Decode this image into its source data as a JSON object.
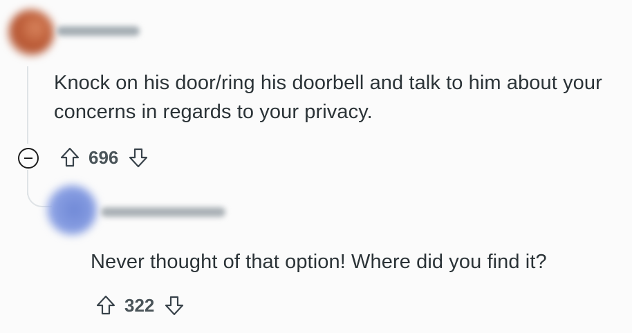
{
  "comments": [
    {
      "body": "Knock on his door/ring his doorbell and talk to him about your concerns in regards to your privacy.",
      "score": "696",
      "avatar_color": "#c8704d"
    },
    {
      "body": "Never thought of that option! Where did you find it?",
      "score": "322",
      "avatar_color": "#7b93dc"
    }
  ],
  "icons": {
    "upvote": "upvote-arrow-icon",
    "downvote": "downvote-arrow-icon",
    "collapse": "collapse-minus-icon"
  },
  "colors": {
    "background": "#fbfbfb",
    "text": "#2b3337",
    "muted": "#4a5459",
    "thread_line": "#dfe3e6"
  }
}
